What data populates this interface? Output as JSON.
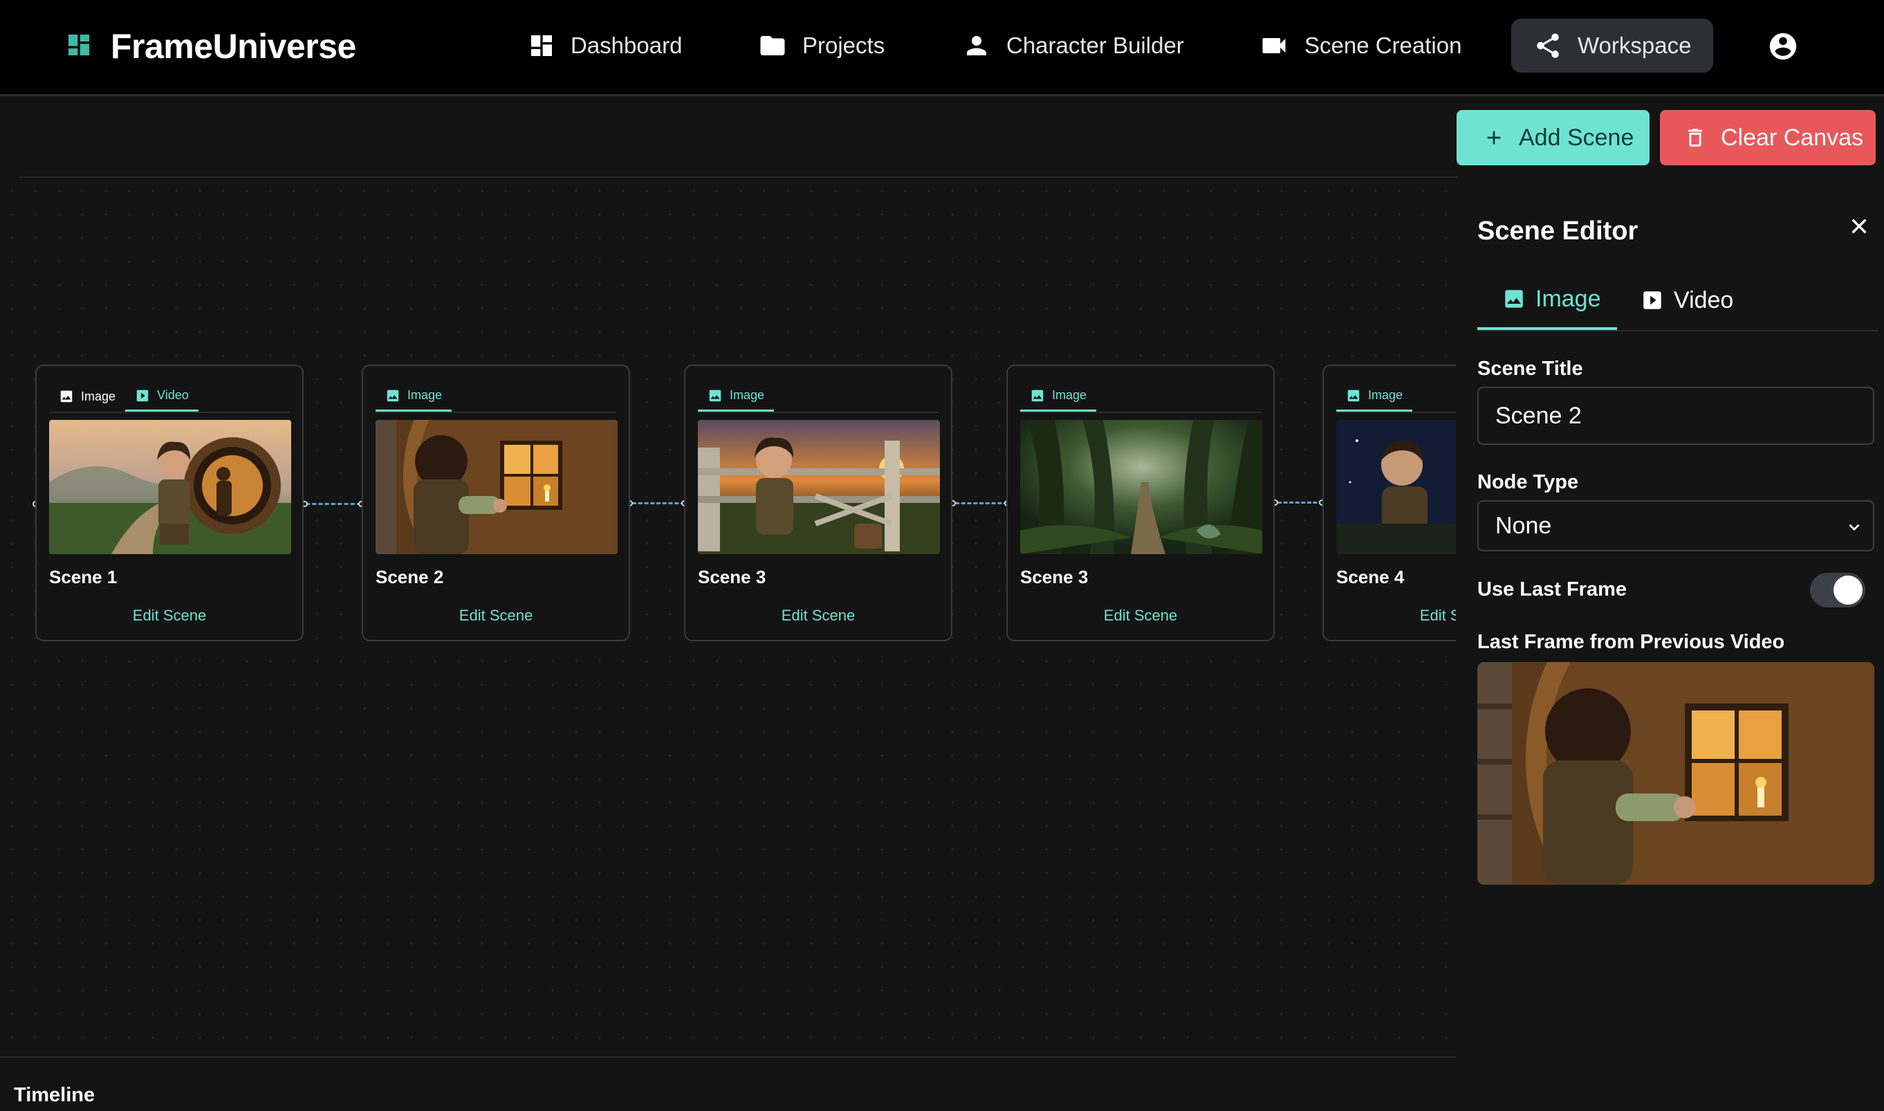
{
  "app": {
    "name": "FrameUniverse"
  },
  "nav": {
    "items": [
      {
        "label": "Dashboard",
        "icon": "dashboard-icon"
      },
      {
        "label": "Projects",
        "icon": "folder-icon"
      },
      {
        "label": "Character Builder",
        "icon": "person-icon"
      },
      {
        "label": "Scene Creation",
        "icon": "videocam-icon"
      },
      {
        "label": "Workspace",
        "icon": "share-icon",
        "active": true
      }
    ],
    "profile_icon": "account-circle-icon"
  },
  "toolbar": {
    "add_scene": "Add Scene",
    "clear_canvas": "Clear Canvas"
  },
  "canvas": {
    "nodes": [
      {
        "title": "Scene 1",
        "tabs": [
          "Image",
          "Video"
        ],
        "active_tab": "Video",
        "edit": "Edit Scene"
      },
      {
        "title": "Scene 2",
        "tabs": [
          "Image"
        ],
        "active_tab": "Image",
        "edit": "Edit Scene"
      },
      {
        "title": "Scene 3",
        "tabs": [
          "Image"
        ],
        "active_tab": "Image",
        "edit": "Edit Scene"
      },
      {
        "title": "Scene 3",
        "tabs": [
          "Image"
        ],
        "active_tab": "Image",
        "edit": "Edit Scene"
      },
      {
        "title": "Scene 4",
        "tabs": [
          "Image"
        ],
        "active_tab": "Image",
        "edit": "Edit Scene"
      }
    ]
  },
  "timeline": {
    "label": "Timeline"
  },
  "editor": {
    "title": "Scene Editor",
    "tabs": [
      {
        "label": "Image",
        "active": true
      },
      {
        "label": "Video",
        "active": false
      }
    ],
    "scene_title_label": "Scene Title",
    "scene_title_value": "Scene 2",
    "node_type_label": "Node Type",
    "node_type_value": "None",
    "use_last_frame_label": "Use Last Frame",
    "use_last_frame": true,
    "last_frame_label": "Last Frame from Previous Video"
  },
  "colors": {
    "accent": "#6fe3d3",
    "danger": "#e8585b",
    "edge": "#4fa7d8",
    "background": "#141414"
  }
}
